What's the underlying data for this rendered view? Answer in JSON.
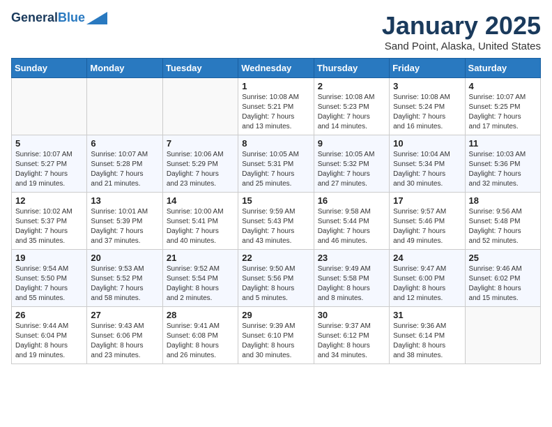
{
  "header": {
    "logo_line1": "General",
    "logo_line2": "Blue",
    "month": "January 2025",
    "location": "Sand Point, Alaska, United States"
  },
  "weekdays": [
    "Sunday",
    "Monday",
    "Tuesday",
    "Wednesday",
    "Thursday",
    "Friday",
    "Saturday"
  ],
  "weeks": [
    [
      {
        "day": "",
        "info": ""
      },
      {
        "day": "",
        "info": ""
      },
      {
        "day": "",
        "info": ""
      },
      {
        "day": "1",
        "info": "Sunrise: 10:08 AM\nSunset: 5:21 PM\nDaylight: 7 hours\nand 13 minutes."
      },
      {
        "day": "2",
        "info": "Sunrise: 10:08 AM\nSunset: 5:23 PM\nDaylight: 7 hours\nand 14 minutes."
      },
      {
        "day": "3",
        "info": "Sunrise: 10:08 AM\nSunset: 5:24 PM\nDaylight: 7 hours\nand 16 minutes."
      },
      {
        "day": "4",
        "info": "Sunrise: 10:07 AM\nSunset: 5:25 PM\nDaylight: 7 hours\nand 17 minutes."
      }
    ],
    [
      {
        "day": "5",
        "info": "Sunrise: 10:07 AM\nSunset: 5:27 PM\nDaylight: 7 hours\nand 19 minutes."
      },
      {
        "day": "6",
        "info": "Sunrise: 10:07 AM\nSunset: 5:28 PM\nDaylight: 7 hours\nand 21 minutes."
      },
      {
        "day": "7",
        "info": "Sunrise: 10:06 AM\nSunset: 5:29 PM\nDaylight: 7 hours\nand 23 minutes."
      },
      {
        "day": "8",
        "info": "Sunrise: 10:05 AM\nSunset: 5:31 PM\nDaylight: 7 hours\nand 25 minutes."
      },
      {
        "day": "9",
        "info": "Sunrise: 10:05 AM\nSunset: 5:32 PM\nDaylight: 7 hours\nand 27 minutes."
      },
      {
        "day": "10",
        "info": "Sunrise: 10:04 AM\nSunset: 5:34 PM\nDaylight: 7 hours\nand 30 minutes."
      },
      {
        "day": "11",
        "info": "Sunrise: 10:03 AM\nSunset: 5:36 PM\nDaylight: 7 hours\nand 32 minutes."
      }
    ],
    [
      {
        "day": "12",
        "info": "Sunrise: 10:02 AM\nSunset: 5:37 PM\nDaylight: 7 hours\nand 35 minutes."
      },
      {
        "day": "13",
        "info": "Sunrise: 10:01 AM\nSunset: 5:39 PM\nDaylight: 7 hours\nand 37 minutes."
      },
      {
        "day": "14",
        "info": "Sunrise: 10:00 AM\nSunset: 5:41 PM\nDaylight: 7 hours\nand 40 minutes."
      },
      {
        "day": "15",
        "info": "Sunrise: 9:59 AM\nSunset: 5:43 PM\nDaylight: 7 hours\nand 43 minutes."
      },
      {
        "day": "16",
        "info": "Sunrise: 9:58 AM\nSunset: 5:44 PM\nDaylight: 7 hours\nand 46 minutes."
      },
      {
        "day": "17",
        "info": "Sunrise: 9:57 AM\nSunset: 5:46 PM\nDaylight: 7 hours\nand 49 minutes."
      },
      {
        "day": "18",
        "info": "Sunrise: 9:56 AM\nSunset: 5:48 PM\nDaylight: 7 hours\nand 52 minutes."
      }
    ],
    [
      {
        "day": "19",
        "info": "Sunrise: 9:54 AM\nSunset: 5:50 PM\nDaylight: 7 hours\nand 55 minutes."
      },
      {
        "day": "20",
        "info": "Sunrise: 9:53 AM\nSunset: 5:52 PM\nDaylight: 7 hours\nand 58 minutes."
      },
      {
        "day": "21",
        "info": "Sunrise: 9:52 AM\nSunset: 5:54 PM\nDaylight: 8 hours\nand 2 minutes."
      },
      {
        "day": "22",
        "info": "Sunrise: 9:50 AM\nSunset: 5:56 PM\nDaylight: 8 hours\nand 5 minutes."
      },
      {
        "day": "23",
        "info": "Sunrise: 9:49 AM\nSunset: 5:58 PM\nDaylight: 8 hours\nand 8 minutes."
      },
      {
        "day": "24",
        "info": "Sunrise: 9:47 AM\nSunset: 6:00 PM\nDaylight: 8 hours\nand 12 minutes."
      },
      {
        "day": "25",
        "info": "Sunrise: 9:46 AM\nSunset: 6:02 PM\nDaylight: 8 hours\nand 15 minutes."
      }
    ],
    [
      {
        "day": "26",
        "info": "Sunrise: 9:44 AM\nSunset: 6:04 PM\nDaylight: 8 hours\nand 19 minutes."
      },
      {
        "day": "27",
        "info": "Sunrise: 9:43 AM\nSunset: 6:06 PM\nDaylight: 8 hours\nand 23 minutes."
      },
      {
        "day": "28",
        "info": "Sunrise: 9:41 AM\nSunset: 6:08 PM\nDaylight: 8 hours\nand 26 minutes."
      },
      {
        "day": "29",
        "info": "Sunrise: 9:39 AM\nSunset: 6:10 PM\nDaylight: 8 hours\nand 30 minutes."
      },
      {
        "day": "30",
        "info": "Sunrise: 9:37 AM\nSunset: 6:12 PM\nDaylight: 8 hours\nand 34 minutes."
      },
      {
        "day": "31",
        "info": "Sunrise: 9:36 AM\nSunset: 6:14 PM\nDaylight: 8 hours\nand 38 minutes."
      },
      {
        "day": "",
        "info": ""
      }
    ]
  ]
}
